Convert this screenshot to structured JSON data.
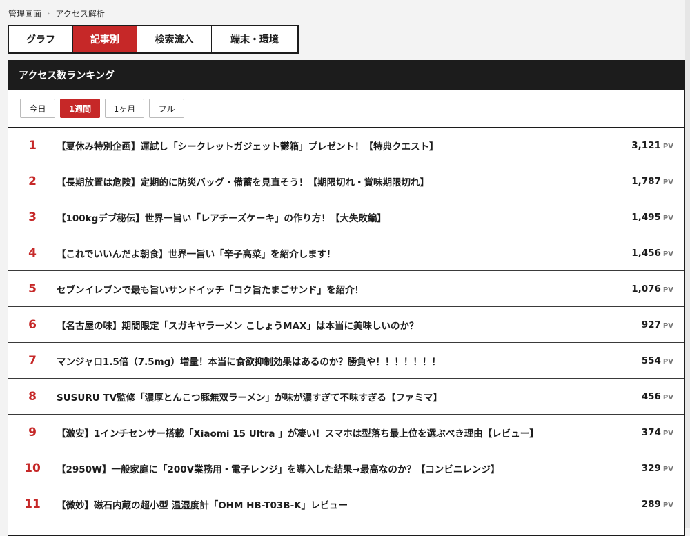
{
  "breadcrumb": {
    "root": "管理画面",
    "separator": "›",
    "current": "アクセス解析"
  },
  "tabs": [
    {
      "label": "グラフ",
      "active": false
    },
    {
      "label": "記事別",
      "active": true
    },
    {
      "label": "検索流入",
      "active": false
    },
    {
      "label": "端末・環境",
      "active": false
    }
  ],
  "panel": {
    "title": "アクセス数ランキング"
  },
  "periods": [
    {
      "label": "今日",
      "active": false
    },
    {
      "label": "1週間",
      "active": true
    },
    {
      "label": "1ヶ月",
      "active": false
    },
    {
      "label": "フル",
      "active": false
    }
  ],
  "pv_unit": "PV",
  "accent_color": "#c62828",
  "ranking": [
    {
      "rank": "1",
      "title": "【夏休み特別企画】運試し「シークレットガジェット鬱箱」プレゼント！【特典クエスト】",
      "pv": "3,121"
    },
    {
      "rank": "2",
      "title": "【長期放置は危険】定期的に防災バッグ・備蓄を見直そう！【期限切れ・賞味期限切れ】",
      "pv": "1,787"
    },
    {
      "rank": "3",
      "title": "【100kgデブ秘伝】世界一旨い「レアチーズケーキ」の作り方！【大失敗編】",
      "pv": "1,495"
    },
    {
      "rank": "4",
      "title": "【これでいいんだよ朝食】世界一旨い「辛子高菜」を紹介します！",
      "pv": "1,456"
    },
    {
      "rank": "5",
      "title": "セブンイレブンで最も旨いサンドイッチ「コク旨たまごサンド」を紹介！",
      "pv": "1,076"
    },
    {
      "rank": "6",
      "title": "【名古屋の味】期間限定「スガキヤラーメン こしょうMAX」は本当に美味しいのか？",
      "pv": "927"
    },
    {
      "rank": "7",
      "title": "マンジャロ1.5倍（7.5mg）増量！本当に食欲抑制効果はあるのか？勝負や！！！！！！！",
      "pv": "554"
    },
    {
      "rank": "8",
      "title": "SUSURU TV監修「濃厚とんこつ豚無双ラーメン」が味が濃すぎて不味すぎる【ファミマ】",
      "pv": "456"
    },
    {
      "rank": "9",
      "title": "【激安】1インチセンサー搭載「Xiaomi 15 Ultra 」が凄い！スマホは型落ち最上位を選ぶべき理由【レビュー】",
      "pv": "374"
    },
    {
      "rank": "10",
      "title": "【2950W】一般家庭に「200V業務用・電子レンジ」を導入した結果→最高なのか？【コンビニレンジ】",
      "pv": "329"
    },
    {
      "rank": "11",
      "title": "【微妙】磁石内蔵の超小型 温湿度計「OHM HB-T03B-K」レビュー",
      "pv": "289"
    }
  ]
}
